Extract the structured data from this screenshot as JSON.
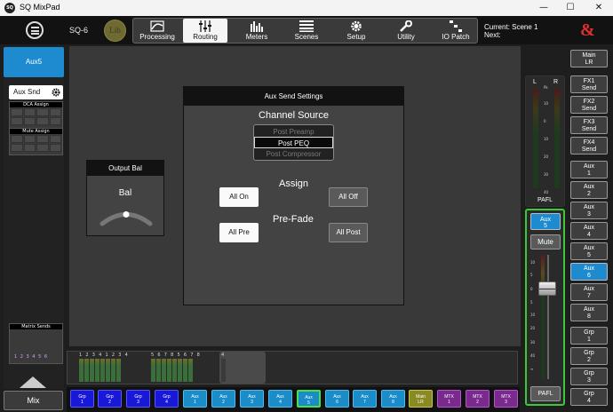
{
  "window": {
    "app_icon": "SQ",
    "title": "SQ MixPad"
  },
  "topbar": {
    "device": "SQ-6",
    "library": "Lib",
    "tabs": [
      {
        "label": "Processing",
        "icon": "processing-icon"
      },
      {
        "label": "Routing",
        "icon": "routing-icon",
        "active": true
      },
      {
        "label": "Meters",
        "icon": "meters-icon"
      },
      {
        "label": "Scenes",
        "icon": "scenes-icon"
      },
      {
        "label": "Setup",
        "icon": "setup-gear-icon"
      },
      {
        "label": "Utility",
        "icon": "utility-wrench-icon"
      },
      {
        "label": "IO Patch",
        "icon": "io-patch-icon"
      }
    ],
    "scene_current": "Current: Scene 1",
    "scene_next": "Next:",
    "logo": "&"
  },
  "left": {
    "selected_mix": "Aux5",
    "aux_snd": "Aux Snd",
    "dca_assign": "DCA Assign",
    "mute_assign": "Mute Assign",
    "matrix_sends": "Matrix Sends",
    "matrix_nums": "1 2 3 4 5 6",
    "mix_button": "Mix"
  },
  "output_bal": {
    "title": "Output Bal",
    "label": "Bal"
  },
  "aux_send": {
    "title": "Aux Send Settings",
    "channel_source": "Channel Source",
    "sources": [
      "Post Preamp",
      "Post PEQ",
      "Post Compressor"
    ],
    "selected_source": "Post PEQ",
    "assign": "Assign",
    "all_on": "All On",
    "all_off": "All Off",
    "prefade": "Pre-Fade",
    "all_pre": "All Pre",
    "all_post": "All Post"
  },
  "meter_strip": {
    "group1": "1 2 3 4 1 2 3 4",
    "group2": "5 6 7 8 5 6 7 8",
    "group3": "4"
  },
  "bottom_buses": [
    {
      "label": "Grp\n1",
      "kind": "grp"
    },
    {
      "label": "Grp\n2",
      "kind": "grp"
    },
    {
      "label": "Grp\n3",
      "kind": "grp"
    },
    {
      "label": "Grp\n4",
      "kind": "grp"
    },
    {
      "label": "Aux\n1",
      "kind": "aux"
    },
    {
      "label": "Aux\n2",
      "kind": "aux"
    },
    {
      "label": "Aux\n3",
      "kind": "aux"
    },
    {
      "label": "Aux\n4",
      "kind": "aux"
    },
    {
      "label": "Aux\n5",
      "kind": "auxsel"
    },
    {
      "label": "Aux\n6",
      "kind": "aux"
    },
    {
      "label": "Aux\n7",
      "kind": "aux"
    },
    {
      "label": "Aux\n8",
      "kind": "aux"
    },
    {
      "label": "Main\nLR",
      "kind": "main"
    },
    {
      "label": "MTX\n1",
      "kind": "mtx"
    },
    {
      "label": "MTX\n2",
      "kind": "mtx"
    },
    {
      "label": "MTX\n3",
      "kind": "mtx"
    }
  ],
  "pafl_meter": {
    "l": "L",
    "r": "R",
    "scale": [
      "Pk",
      "10",
      "0",
      "10",
      "20",
      "30",
      "40"
    ],
    "label": "PAFL"
  },
  "channel_strip": {
    "name": "Aux\n5",
    "mute": "Mute",
    "scale": [
      "10",
      "5",
      "0",
      "5",
      "10",
      "20",
      "30",
      "40",
      "∞"
    ],
    "pafl": "PAFL"
  },
  "right_buttons": [
    {
      "label": "Main\nLR"
    },
    {
      "label": "FX1\nSend"
    },
    {
      "label": "FX2\nSend"
    },
    {
      "label": "FX3\nSend"
    },
    {
      "label": "FX4\nSend"
    },
    {
      "label": "Aux\n1"
    },
    {
      "label": "Aux\n2"
    },
    {
      "label": "Aux\n3"
    },
    {
      "label": "Aux\n4"
    },
    {
      "label": "Aux\n5"
    },
    {
      "label": "Aux\n6",
      "selected": true
    },
    {
      "label": "Aux\n7"
    },
    {
      "label": "Aux\n8"
    },
    {
      "label": "Grp\n1"
    },
    {
      "label": "Grp\n2"
    },
    {
      "label": "Grp\n3"
    },
    {
      "label": "Grp\n4"
    }
  ]
}
